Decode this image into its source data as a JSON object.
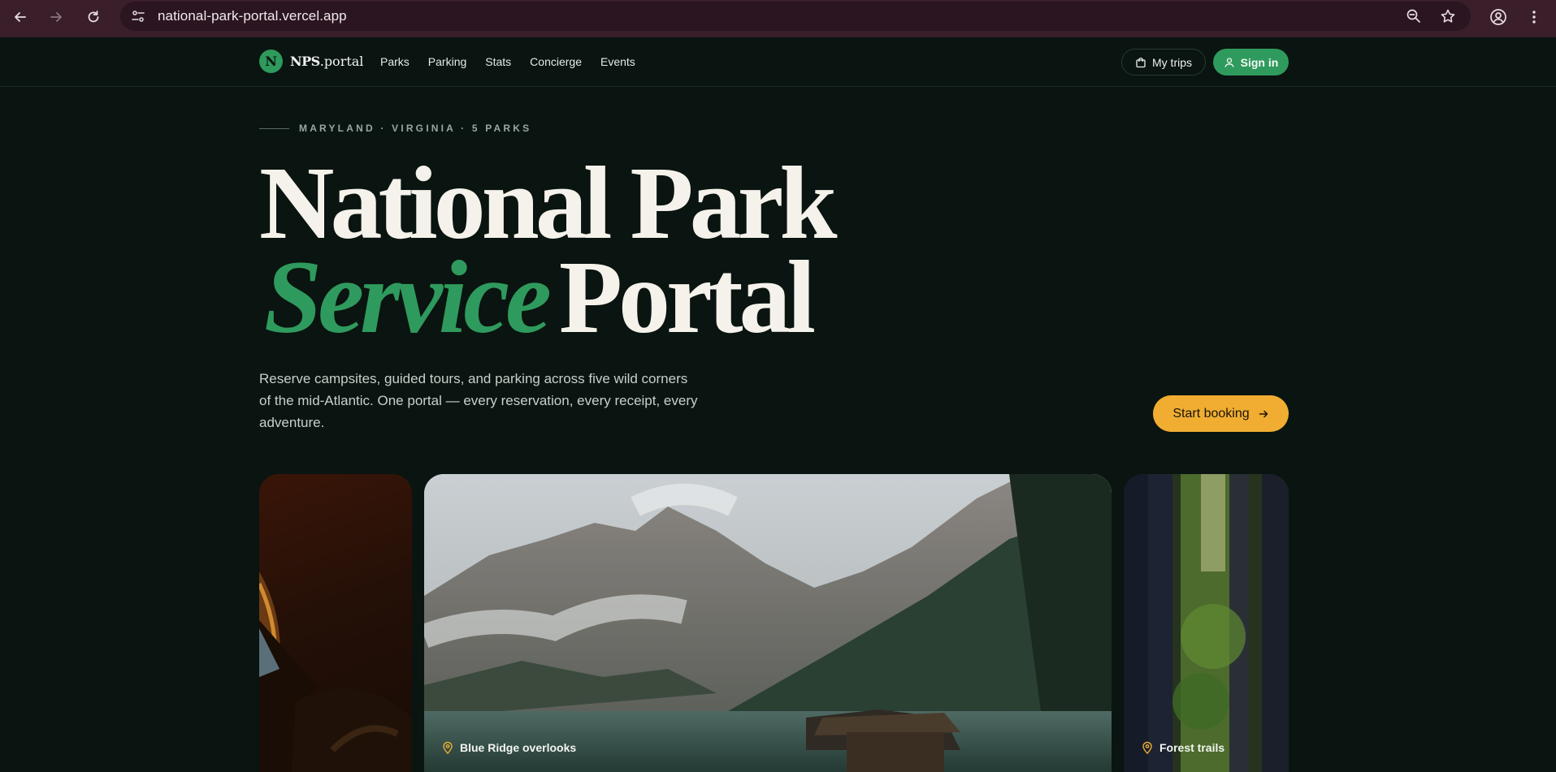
{
  "browser": {
    "url": "national-park-portal.vercel.app"
  },
  "header": {
    "logo_mark": "N",
    "logo_bold": "NPS",
    "logo_rest": "portal",
    "nav": [
      "Parks",
      "Parking",
      "Stats",
      "Concierge",
      "Events"
    ],
    "my_trips": "My trips",
    "sign_in": "Sign in"
  },
  "hero": {
    "eyebrow": "MARYLAND · VIRGINIA · 5 PARKS",
    "title_line1": "National Park",
    "title_accent": "Service",
    "title_line2_rest": "Portal",
    "lead": "Reserve campsites, guided tours, and parking across five wild corners of the mid-Atlantic. One portal — every reservation, every receipt, every adventure.",
    "cta": "Start booking"
  },
  "cards": {
    "middle_label": "Blue Ridge overlooks",
    "right_label": "Forest trails"
  },
  "colors": {
    "background": "#0a1410",
    "brand_green": "#2f9a5d",
    "cta_amber": "#f0ad32",
    "pin_amber": "#f0ad32"
  }
}
